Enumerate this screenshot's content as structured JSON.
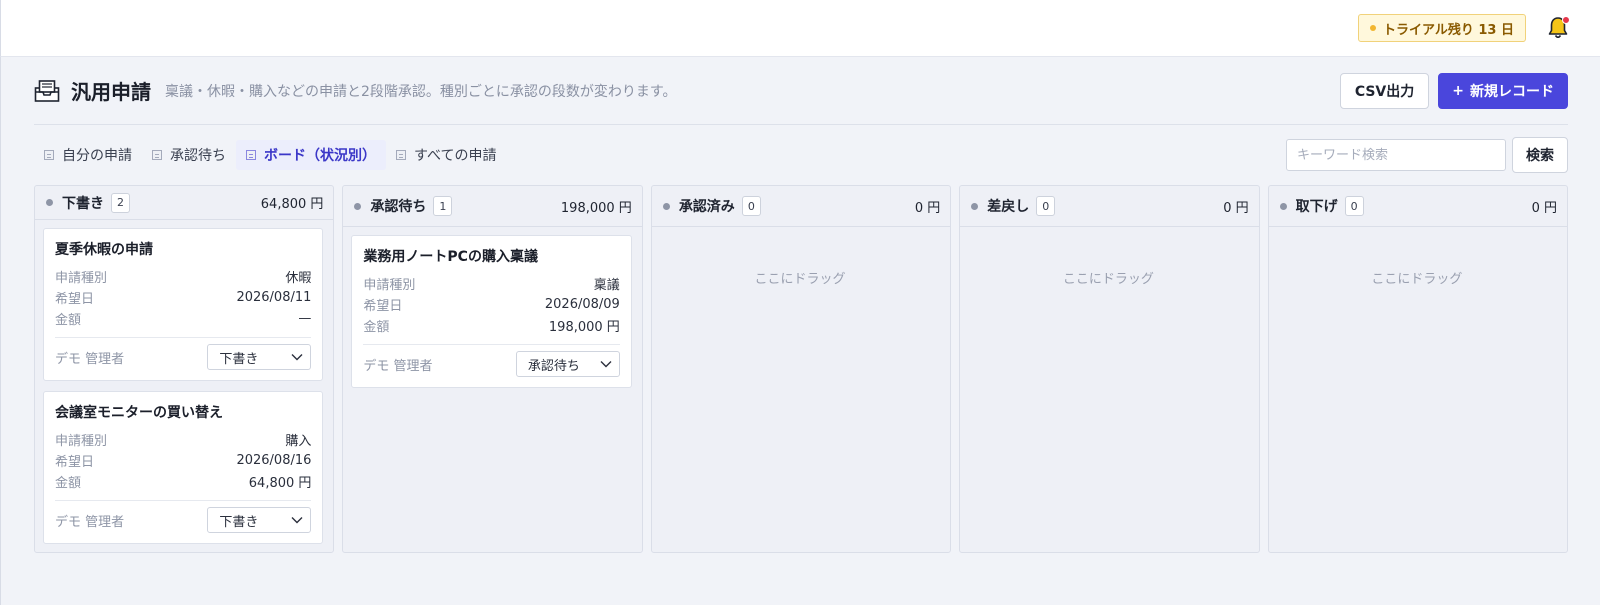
{
  "topbar": {
    "trial_label": "トライアル残り 13 日",
    "bell_icon": "bell-icon"
  },
  "header": {
    "title": "汎用申請",
    "description": "稟議・休暇・購入などの申請と2段階承認。種別ごとに承認の段数が変わります。",
    "csv_label": "CSV出力",
    "new_label": "新規レコード",
    "new_icon": "+"
  },
  "tabs": [
    {
      "label": "自分の申請",
      "active": false
    },
    {
      "label": "承認待ち",
      "active": false
    },
    {
      "label": "ボード（状況別）",
      "active": true
    },
    {
      "label": "すべての申請",
      "active": false
    }
  ],
  "search": {
    "placeholder": "キーワード検索",
    "button_label": "検索"
  },
  "board": {
    "drop_hint": "ここにドラッグ",
    "columns": [
      {
        "name": "下書き",
        "count": "2",
        "total": "64,800 円",
        "cards": [
          {
            "title": "夏季休暇の申請",
            "rows": [
              {
                "label": "申請種別",
                "value": "休暇"
              },
              {
                "label": "希望日",
                "value": "2026/08/11"
              },
              {
                "label": "金額",
                "value": "—"
              }
            ],
            "owner": "デモ 管理者",
            "status": "下書き"
          },
          {
            "title": "会議室モニターの買い替え",
            "rows": [
              {
                "label": "申請種別",
                "value": "購入"
              },
              {
                "label": "希望日",
                "value": "2026/08/16"
              },
              {
                "label": "金額",
                "value": "64,800 円"
              }
            ],
            "owner": "デモ 管理者",
            "status": "下書き"
          }
        ]
      },
      {
        "name": "承認待ち",
        "count": "1",
        "total": "198,000 円",
        "cards": [
          {
            "title": "業務用ノートPCの購入稟議",
            "rows": [
              {
                "label": "申請種別",
                "value": "稟議"
              },
              {
                "label": "希望日",
                "value": "2026/08/09"
              },
              {
                "label": "金額",
                "value": "198,000 円"
              }
            ],
            "owner": "デモ 管理者",
            "status": "承認待ち"
          }
        ]
      },
      {
        "name": "承認済み",
        "count": "0",
        "total": "0 円",
        "cards": []
      },
      {
        "name": "差戻し",
        "count": "0",
        "total": "0 円",
        "cards": []
      },
      {
        "name": "取下げ",
        "count": "0",
        "total": "0 円",
        "cards": []
      }
    ]
  },
  "colors": {
    "accent": "#4a46dc",
    "trial_bg": "#fff8dc",
    "bell_dot": "#e5364b"
  }
}
